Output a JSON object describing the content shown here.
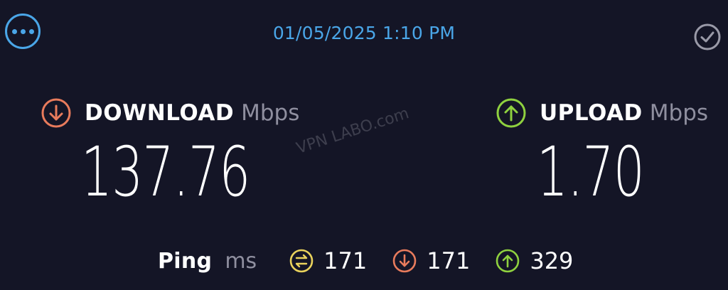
{
  "header": {
    "timestamp": "01/05/2025 1:10 PM",
    "more_icon": "ellipsis-circle-icon",
    "check_icon": "check-circle-icon"
  },
  "download": {
    "title": "DOWNLOAD",
    "unit": "Mbps",
    "value": "137.76",
    "icon": "download-arrow-icon",
    "color": "#e87b5c"
  },
  "upload": {
    "title": "UPLOAD",
    "unit": "Mbps",
    "value": "1.70",
    "icon": "upload-arrow-icon",
    "color": "#8fd13f"
  },
  "watermark": "VPN LABO.com",
  "ping": {
    "label": "Ping",
    "unit": "ms",
    "idle_value": "171",
    "download_value": "171",
    "upload_value": "329",
    "idle_color": "#e9d25c"
  },
  "colors": {
    "background": "#141526",
    "accent": "#4aa6e8",
    "muted": "#8f8f9f"
  }
}
